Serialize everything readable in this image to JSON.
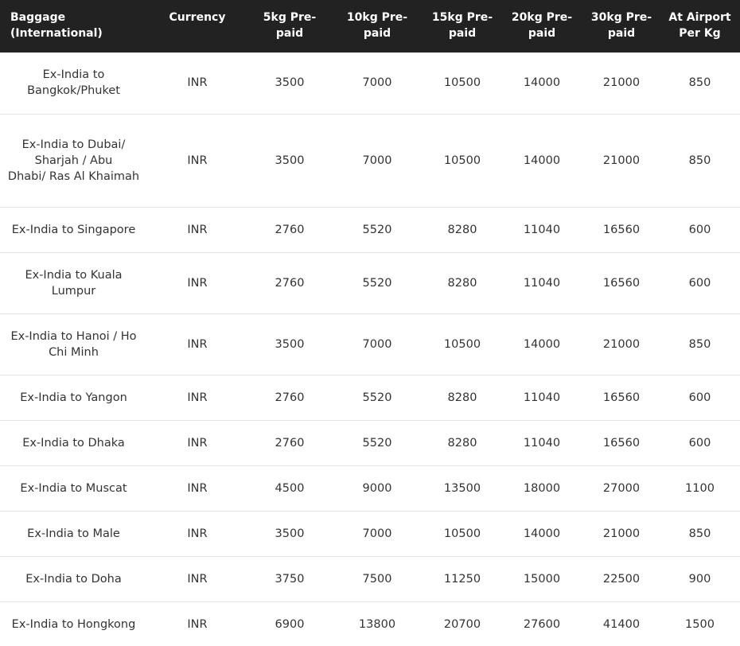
{
  "table": {
    "headers": [
      [
        "Baggage (International)"
      ],
      [
        "Currency"
      ],
      [
        "5kg Pre-",
        "paid"
      ],
      [
        "10kg Pre-",
        "paid"
      ],
      [
        "15kg Pre-",
        "paid"
      ],
      [
        "20kg Pre-",
        "paid"
      ],
      [
        "30kg Pre-",
        "paid"
      ],
      [
        "At Airport",
        "Per Kg"
      ]
    ],
    "rows": [
      {
        "route": [
          "Ex-India to",
          "Bangkok/Phuket"
        ],
        "currency": "INR",
        "p5": "3500",
        "p10": "7000",
        "p15": "10500",
        "p20": "14000",
        "p30": "21000",
        "airport": "850"
      },
      {
        "route": [
          "Ex-India to  Dubai/",
          "Sharjah / Abu",
          "Dhabi/ Ras Al Khaimah"
        ],
        "currency": "INR",
        "p5": "3500",
        "p10": "7000",
        "p15": "10500",
        "p20": "14000",
        "p30": "21000",
        "airport": "850"
      },
      {
        "route": [
          "Ex-India to Singapore"
        ],
        "currency": "INR",
        "p5": "2760",
        "p10": "5520",
        "p15": "8280",
        "p20": "11040",
        "p30": "16560",
        "airport": "600"
      },
      {
        "route": [
          "Ex-India to  Kuala",
          "Lumpur"
        ],
        "currency": "INR",
        "p5": "2760",
        "p10": "5520",
        "p15": "8280",
        "p20": "11040",
        "p30": "16560",
        "airport": "600"
      },
      {
        "route": [
          "Ex-India to Hanoi / Ho",
          "Chi Minh"
        ],
        "currency": "INR",
        "p5": "3500",
        "p10": "7000",
        "p15": "10500",
        "p20": "14000",
        "p30": "21000",
        "airport": "850"
      },
      {
        "route": [
          "Ex-India to Yangon"
        ],
        "currency": "INR",
        "p5": "2760",
        "p10": "5520",
        "p15": "8280",
        "p20": "11040",
        "p30": "16560",
        "airport": "600"
      },
      {
        "route": [
          "Ex-India to Dhaka"
        ],
        "currency": "INR",
        "p5": "2760",
        "p10": "5520",
        "p15": "8280",
        "p20": "11040",
        "p30": "16560",
        "airport": "600"
      },
      {
        "route": [
          "Ex-India to Muscat"
        ],
        "currency": "INR",
        "p5": "4500",
        "p10": "9000",
        "p15": "13500",
        "p20": "18000",
        "p30": "27000",
        "airport": "1100"
      },
      {
        "route": [
          "Ex-India to Male"
        ],
        "currency": "INR",
        "p5": "3500",
        "p10": "7000",
        "p15": "10500",
        "p20": "14000",
        "p30": "21000",
        "airport": "850"
      },
      {
        "route": [
          "Ex-India to Doha"
        ],
        "currency": "INR",
        "p5": "3750",
        "p10": "7500",
        "p15": "11250",
        "p20": "15000",
        "p30": "22500",
        "airport": "900"
      },
      {
        "route": [
          "Ex-India to Hongkong"
        ],
        "currency": "INR",
        "p5": "6900",
        "p10": "13800",
        "p15": "20700",
        "p20": "27600",
        "p30": "41400",
        "airport": "1500"
      }
    ]
  }
}
